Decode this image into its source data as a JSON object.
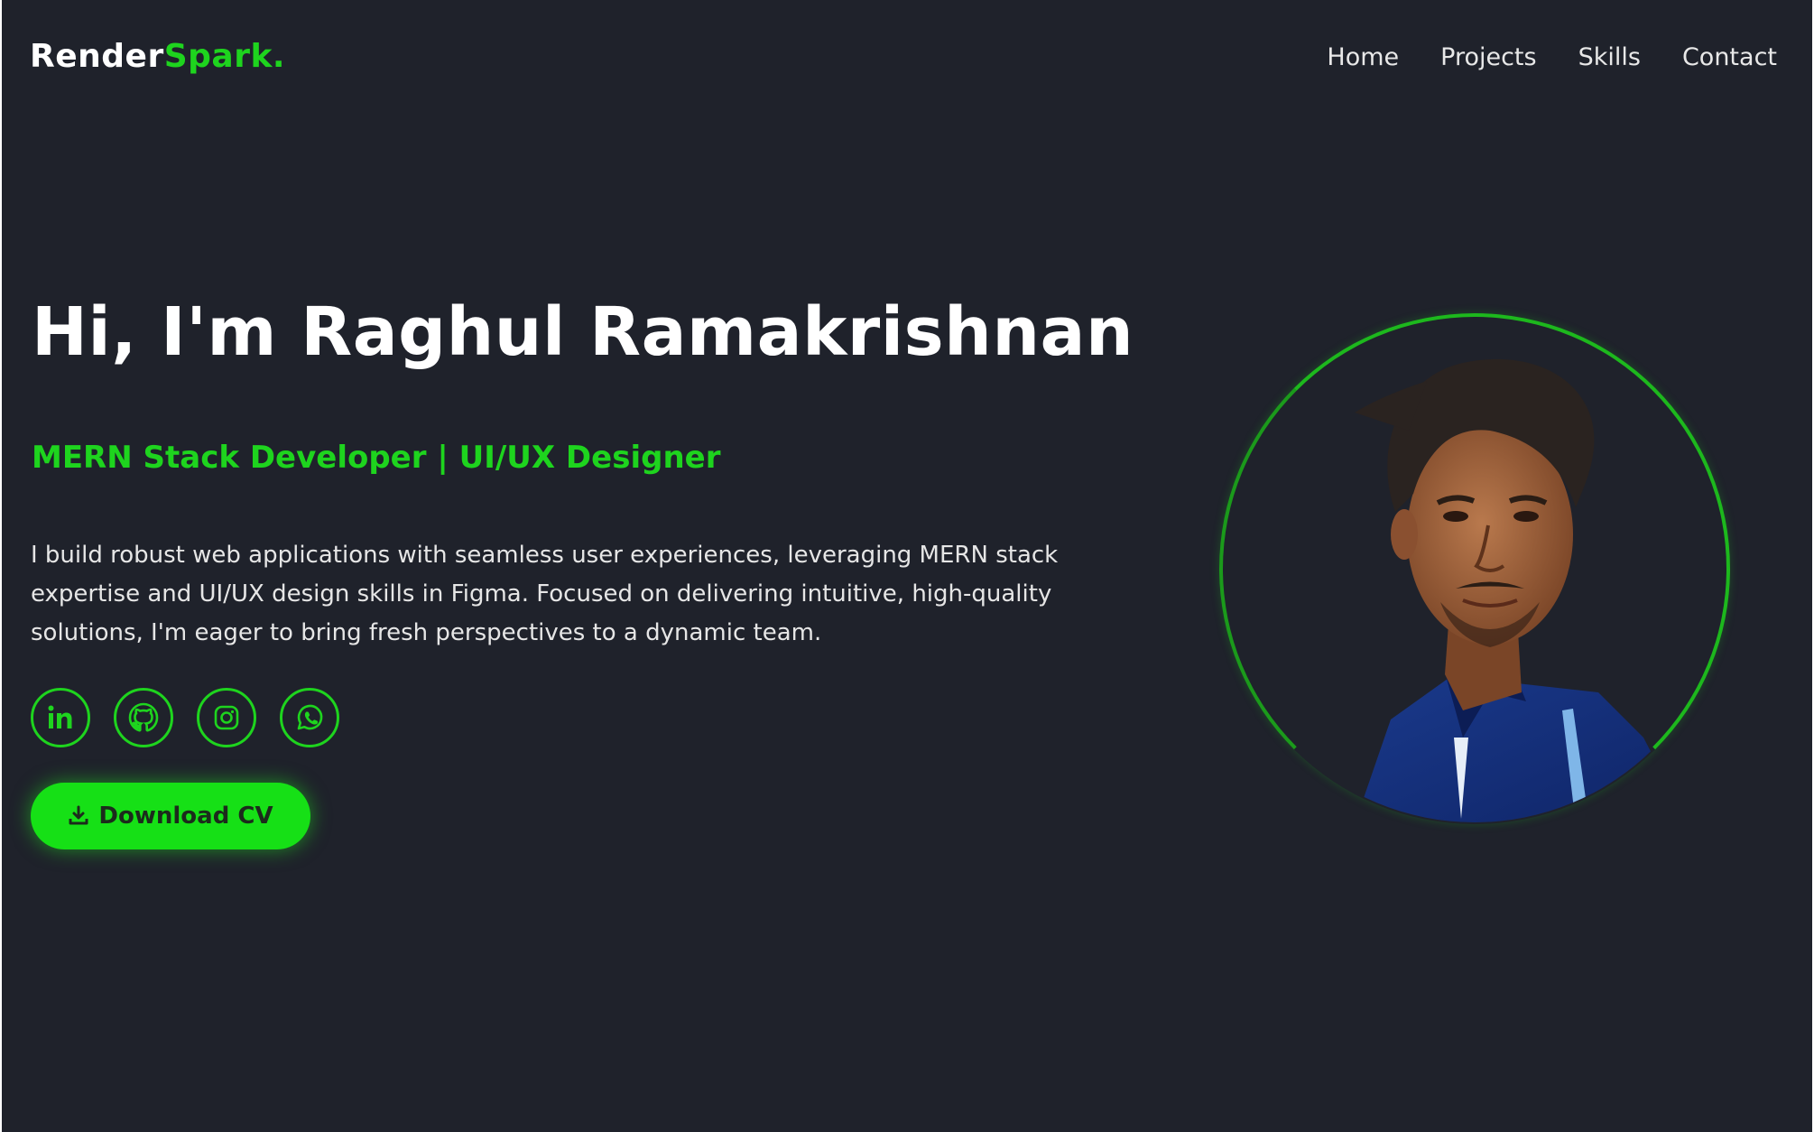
{
  "header": {
    "brand_main": "Render",
    "brand_accent": "Spark.",
    "nav": [
      {
        "label": "Home"
      },
      {
        "label": "Projects"
      },
      {
        "label": "Skills"
      },
      {
        "label": "Contact"
      }
    ]
  },
  "hero": {
    "title": "Hi, I'm Raghul Ramakrishnan",
    "subtitle": "MERN Stack Developer | UI/UX Designer",
    "bio": "I build robust web applications with seamless user experiences, leveraging MERN stack expertise and UI/UX design skills in Figma. Focused on delivering intuitive, high-quality solutions, I'm eager to bring fresh perspectives to a dynamic team.",
    "socials": [
      {
        "icon": "linkedin-icon"
      },
      {
        "icon": "github-icon"
      },
      {
        "icon": "instagram-icon"
      },
      {
        "icon": "whatsapp-icon"
      }
    ],
    "download_label": "Download CV"
  },
  "colors": {
    "background": "#1f222b",
    "accent": "#1ed41e",
    "text": "#ffffff"
  }
}
